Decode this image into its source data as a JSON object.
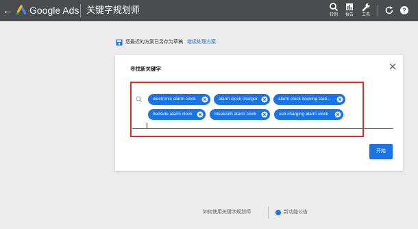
{
  "topbar": {
    "brand": "Google Ads",
    "page_title": "关键字规划师",
    "tools": [
      {
        "icon": "search-icon",
        "label": "转到"
      },
      {
        "icon": "reports-icon",
        "label": "报告"
      },
      {
        "icon": "wrench-icon",
        "label": "工具"
      }
    ],
    "right_icons": [
      "refresh-icon",
      "help-icon"
    ]
  },
  "draft": {
    "text": "您最近的方案已另存为草稿",
    "link": "继续处理方案"
  },
  "card": {
    "title": "寻找新关键字",
    "keywords": [
      "electronic alarm clock",
      "alarm clock charger",
      "alarm clock docking stati...",
      "bedside alarm clock",
      "bluetooth alarm clock",
      "usb charging alarm clock"
    ],
    "start_button": "开始"
  },
  "footer": {
    "how_to": "如何使用关键字规划师",
    "new_features": "新功能公告"
  },
  "colors": {
    "topbar": "#4a4c4f",
    "accent": "#1a73e8",
    "highlight_box": "#d32f2f",
    "background": "#ececec"
  }
}
